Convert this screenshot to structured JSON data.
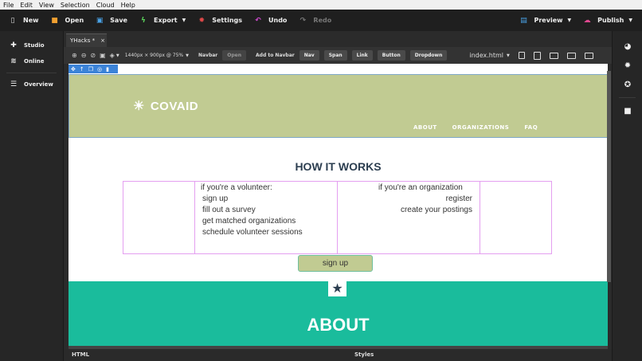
{
  "menubar": {
    "items": [
      "File",
      "Edit",
      "View",
      "Selection",
      "Cloud",
      "Help"
    ]
  },
  "toolbar": {
    "new": "New",
    "open": "Open",
    "save": "Save",
    "export": "Export",
    "settings": "Settings",
    "undo": "Undo",
    "redo": "Redo",
    "preview": "Preview",
    "publish": "Publish"
  },
  "left_panel": {
    "studio": "Studio",
    "online": "Online",
    "overview": "Overview"
  },
  "tab": {
    "label": "YHacks *",
    "close": "×"
  },
  "editor_toolbar": {
    "viewport": "1440px × 900px @ 75%",
    "component": "Navbar",
    "open_btn": "Open",
    "add_to_navbar": "Add to Navbar",
    "add_items": [
      "Nav",
      "Span",
      "Link",
      "Button",
      "Dropdown"
    ],
    "file": "index.html"
  },
  "page": {
    "logo": "COVAID",
    "nav": [
      "ABOUT",
      "ORGANIZATIONS",
      "FAQ"
    ],
    "how_title": "HOW IT WORKS",
    "volunteer_lines": [
      "if you're a volunteer:",
      "sign up",
      "fill out a survey",
      "get matched organizations",
      "schedule volunteer sessions"
    ],
    "org_lines": [
      "if you're an organization",
      "register",
      "create your postings"
    ],
    "signup_btn": "sign up",
    "about_title": "ABOUT"
  },
  "bottom": {
    "html": "HTML",
    "styles": "Styles"
  },
  "colors": {
    "header": "#c1cb92",
    "about": "#1abc9c",
    "accent": "#3b83d8"
  }
}
